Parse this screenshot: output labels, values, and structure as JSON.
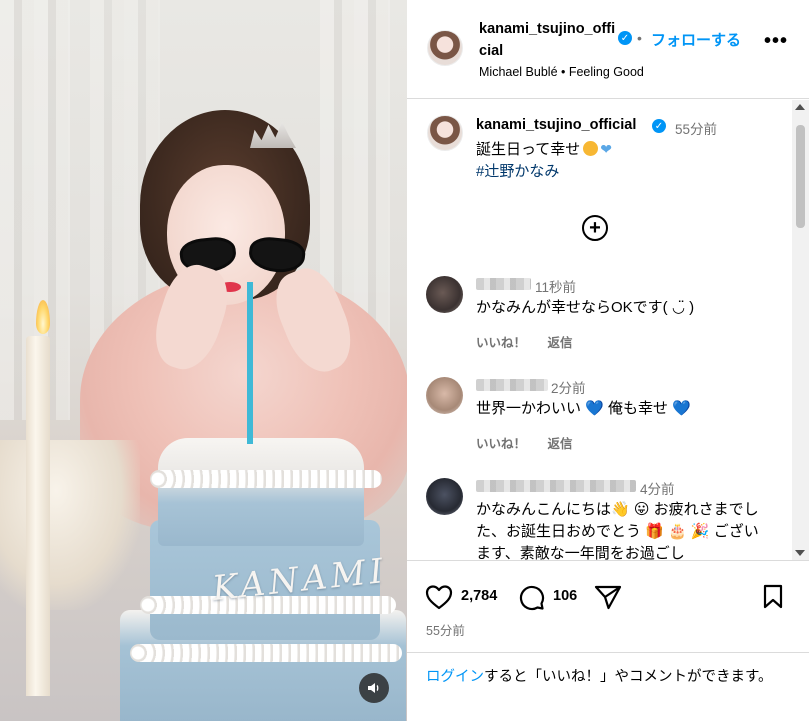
{
  "media": {
    "cake_lettering": "KANAMI"
  },
  "header": {
    "username": "kanami_tsujino_official",
    "verified_icon": "verified-badge-icon",
    "dot": "•",
    "follow_label": "フォローする",
    "more_label": "•••",
    "music_text": "Michael Bublé • Feeling Good"
  },
  "caption": {
    "username": "kanami_tsujino_official",
    "time": "55分前",
    "text": "誕生日って幸せ",
    "hashtag": "#辻野かなみ"
  },
  "comments": [
    {
      "time": "11秒前",
      "text": "かなみんが幸せならOKです( ◡̈ )",
      "like_label": "いいね！",
      "reply_label": "返信"
    },
    {
      "time": "2分前",
      "text": "世界一かわいい 💙 俺も幸せ 💙",
      "like_label": "いいね！",
      "reply_label": "返信"
    },
    {
      "time": "4分前",
      "text": "かなみんこんにちは👋 😛 お疲れさまでした、お誕生日おめでとう 🎁 🎂 🎉 ございます、素敵な一年間をお過ごし",
      "like_label": "いいね！",
      "reply_label": "返信"
    }
  ],
  "actions": {
    "likes": "2,784",
    "comments": "106",
    "time": "55分前"
  },
  "login": {
    "link": "ログイン",
    "text": "すると「いいね！」やコメントができます。"
  },
  "colors": {
    "accent": "#0095f6",
    "muted": "#737373",
    "divider": "#dbdbdb"
  }
}
